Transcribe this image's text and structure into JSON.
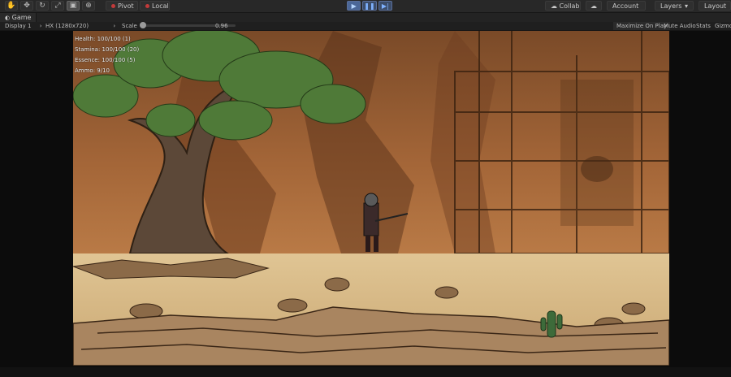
{
  "toolbar": {
    "tool_icons": [
      "hand-tool-icon",
      "move-tool-icon",
      "rotate-tool-icon",
      "scale-tool-icon",
      "rect-tool-icon",
      "transform-tool-icon"
    ],
    "pivot_label": "Pivot",
    "local_label": "Local",
    "collab_label": "Collab",
    "account_label": "Account",
    "layers_label": "Layers",
    "layout_label": "Layout"
  },
  "game_tab": {
    "label": "Game"
  },
  "game_toolbar": {
    "display_label": "Display 1",
    "resolution_label": "HX (1280x720)",
    "scale_label": "Scale",
    "scale_value": "0.96",
    "scale_fraction": 0.02,
    "maximize_label": "Maximize On Play",
    "mute_label": "Mute Audio",
    "stats_label": "Stats",
    "gizmos_label": "Gizmos"
  },
  "hud": {
    "health": "Health: 100/100 (1)",
    "stamina": "Stamina: 100/100 (20)",
    "essence": "Essence: 100/100 (5)",
    "ammo": "Ammo: 9/10"
  },
  "colors": {
    "accent": "#5a87d6",
    "editor_dark": "#282828",
    "sky_brown": "#9a5f33",
    "ground_sand": "#d0b48a"
  }
}
